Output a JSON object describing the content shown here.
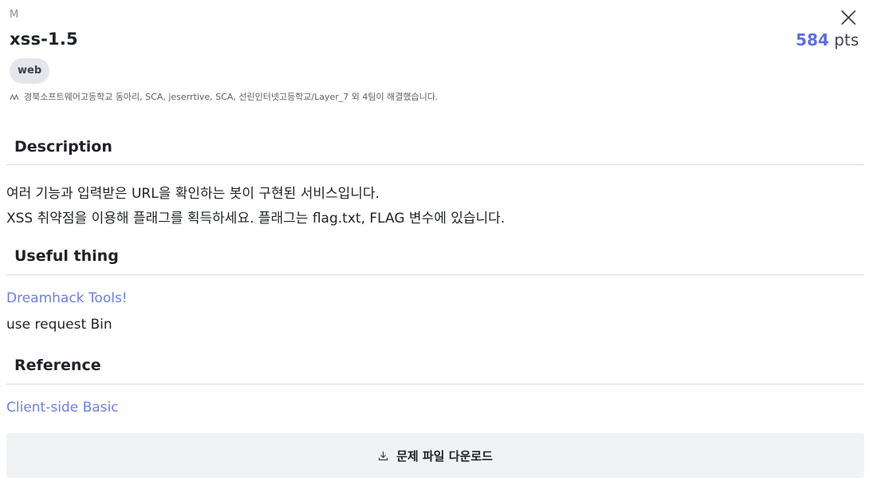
{
  "challenge": {
    "difficulty": "M",
    "title": "xss-1.5",
    "points_value": "584",
    "points_unit": "pts",
    "tag": "web",
    "solvers_text": "경북소프트웨어고등학교 동아리, SCA, jeserrtive, SCA, 선린인터넷고등학교/Layer_7 외 4팀이 해결했습니다."
  },
  "description": {
    "heading": "Description",
    "line1": "여러 기능과 입력받은 URL을 확인하는 봇이 구현된 서비스입니다.",
    "line2": "XSS 취약점을 이용해 플래그를 획득하세요. 플래그는 flag.txt, FLAG 변수에 있습니다."
  },
  "useful": {
    "heading": "Useful thing",
    "link": "Dreamhack Tools!",
    "text": "use request Bin"
  },
  "reference": {
    "heading": "Reference",
    "link": "Client-side Basic"
  },
  "download": {
    "label": "문제 파일 다운로드"
  },
  "colors": {
    "accent": "#5b6ee8",
    "link": "#6b7ef0",
    "tag_bg": "#e4e6eb",
    "button_bg": "#f1f2f4"
  },
  "icons": {
    "close": "close-icon",
    "solvers": "people-icon",
    "download": "download-icon"
  }
}
